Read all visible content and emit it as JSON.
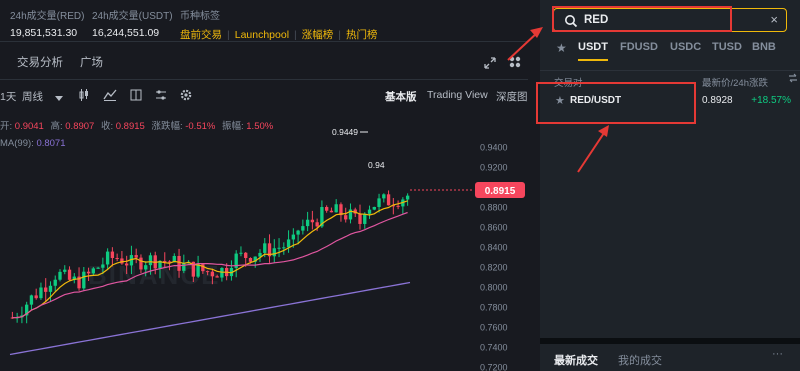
{
  "stats": {
    "vol_red_label": "24h成交量(RED)",
    "vol_red_value": "19,851,531.30",
    "vol_usdt_label": "24h成交量(USDT)",
    "vol_usdt_value": "16,244,551.09",
    "tags_label": "币种标签",
    "tags": [
      "盘前交易",
      "Launchpool",
      "涨幅榜",
      "热门榜"
    ]
  },
  "subnav": {
    "tabs": [
      "交易分析",
      "广场"
    ],
    "icons": [
      "expand-icon",
      "grid-icon"
    ]
  },
  "toolbar": {
    "interval": "1天",
    "period": "周线",
    "views": [
      "基本版",
      "Trading View",
      "深度图"
    ],
    "icons": [
      "caret-down-icon",
      "candle-type-icon",
      "indicator-icon",
      "layout-icon",
      "settings-icon"
    ]
  },
  "ohlc": {
    "open_label": "开:",
    "open": "0.9041",
    "high_label": "高:",
    "high": "0.8907",
    "close_label": "收:",
    "close": "0.8915",
    "amp_label": "涨跌幅:",
    "amp": "-0.51%",
    "range_label": "振幅:",
    "range": "1.50%"
  },
  "ma": {
    "label": "MA(99):",
    "value": "0.8071"
  },
  "chart_data": {
    "type": "line",
    "y_ticks": [
      "0.9400",
      "0.9200",
      "0.9000",
      "0.8800",
      "0.8600",
      "0.8400",
      "0.8200",
      "0.8000",
      "0.7800",
      "0.7600",
      "0.7400",
      "0.7200"
    ],
    "ylim": [
      0.7175,
      0.9575
    ],
    "high_marker": "0.9449",
    "partial_marker": "0.94",
    "current_price": "0.8915",
    "watermark": "BINANCE",
    "colors": {
      "up": "#0ecb81",
      "down": "#f6465d",
      "ma_short": "#f0b90b",
      "ma_mid": "#e056a0",
      "ma_long": "#8a73d6"
    }
  },
  "search": {
    "value": "RED",
    "clear": "×",
    "icon": "search-icon"
  },
  "quote_tabs": [
    "USDT",
    "FDUSD",
    "USDC",
    "TUSD",
    "BNB"
  ],
  "pair_header": {
    "pair": "交易对",
    "price": "最新价/24h涨跌"
  },
  "pair_row": {
    "name": "RED/USDT",
    "price": "0.8928",
    "change": "+18.57%"
  },
  "trades": {
    "tabs": [
      "最新成交",
      "我的成交"
    ],
    "more": "···"
  },
  "annotation_color": "#e53935"
}
